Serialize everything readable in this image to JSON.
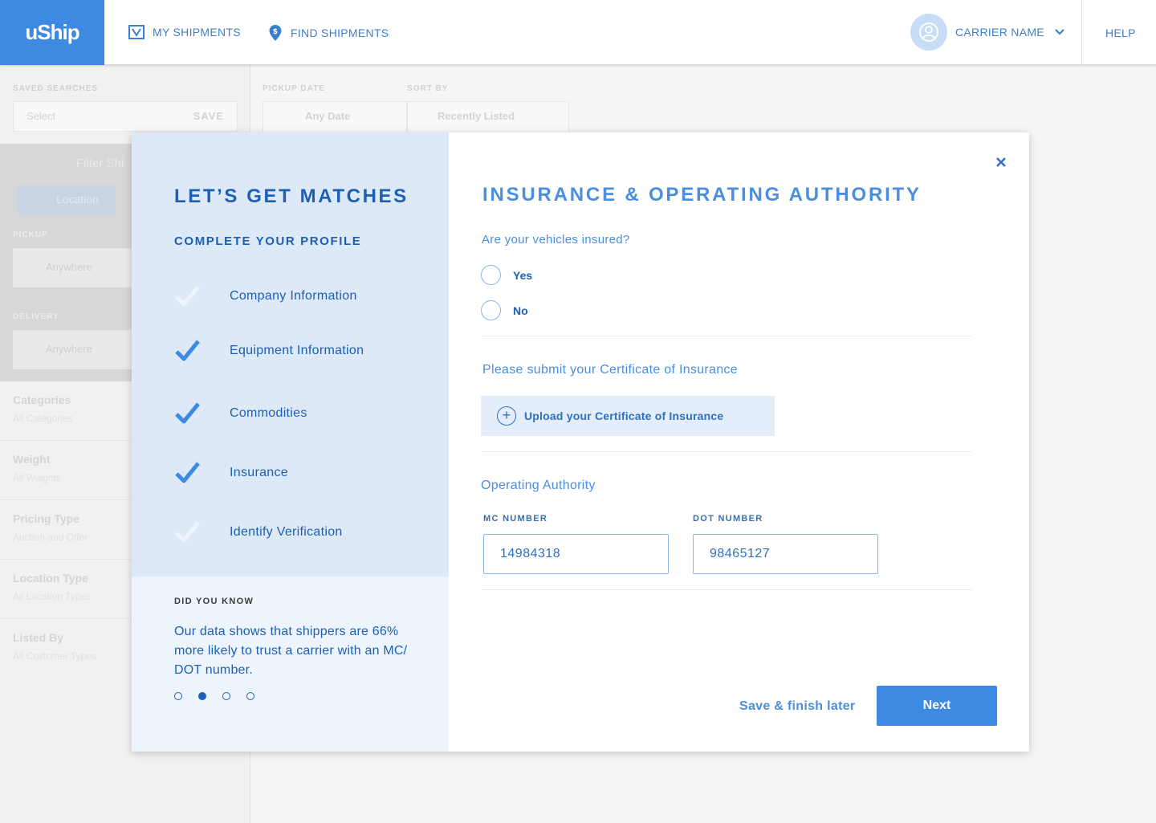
{
  "nav": {
    "logo": "uShip",
    "my_shipments": "MY SHIPMENTS",
    "find_shipments": "FIND SHIPMENTS",
    "user_name": "CARRIER NAME",
    "help": "HELP"
  },
  "background": {
    "saved_searches_label": "SAVED SEARCHES",
    "saved_search_placeholder": "Select",
    "save_label": "SAVE",
    "pickup_date_label": "PICKUP DATE",
    "pickup_date_value": "Any Date",
    "sort_by_label": "SORT BY",
    "sort_by_value": "Recently Listed",
    "filter_title": "Filter Shi",
    "location_tab": "Location",
    "pickup_label": "PICKUP",
    "pickup_value": "Anywhere",
    "delivery_label": "DELIVERY",
    "delivery_value": "Anywhere",
    "filters": [
      {
        "title": "Categories",
        "sub": "All Categories"
      },
      {
        "title": "Weight",
        "sub": "All Weights"
      },
      {
        "title": "Pricing Type",
        "sub": "Auction and Offer"
      },
      {
        "title": "Location Type",
        "sub": "All Location Types"
      },
      {
        "title": "Listed By",
        "sub": "All Customer Types"
      }
    ]
  },
  "modal": {
    "left": {
      "title": "LET’S GET MATCHES",
      "subtitle": "COMPLETE YOUR PROFILE",
      "steps": [
        {
          "label": "Company Information",
          "done": false
        },
        {
          "label": "Equipment Information",
          "done": true
        },
        {
          "label": "Commodities",
          "done": true
        },
        {
          "label": "Insurance",
          "done": true
        },
        {
          "label": "Identify Verification",
          "done": false
        }
      ],
      "did_you_know_title": "DID YOU KNOW",
      "did_you_know_text": "Our data shows that shippers are 66% more likely to trust a carrier with an MC/ DOT number.",
      "carousel_active_index": 1,
      "carousel_count": 4
    },
    "right": {
      "title": "INSURANCE & OPERATING AUTHORITY",
      "question": "Are your vehicles insured?",
      "options": [
        "Yes",
        "No"
      ],
      "certificate_label": "Please submit your Certificate of Insurance",
      "upload_label": "Upload your Certificate of Insurance",
      "operating_authority_label": "Operating Authority",
      "mc_label": "MC NUMBER",
      "mc_value": "14984318",
      "dot_label": "DOT NUMBER",
      "dot_value": "98465127",
      "save_later": "Save & finish later",
      "next": "Next"
    }
  },
  "colors": {
    "brand": "#3d8ae2",
    "navy": "#1d5fb5",
    "accent_light": "#4a8ee0",
    "panel_bg": "#dde9f7"
  }
}
